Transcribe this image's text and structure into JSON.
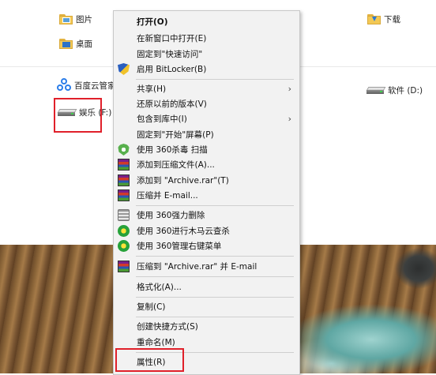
{
  "explorer": {
    "folders": [
      {
        "label": "图片",
        "icon": "pictures-folder-icon"
      },
      {
        "label": "桌面",
        "icon": "desktop-folder-icon"
      },
      {
        "label": "下载",
        "icon": "downloads-folder-icon"
      }
    ],
    "baidu_label": "百度云管家",
    "drives": [
      {
        "label": "娱乐 (F:)",
        "icon": "drive-icon"
      },
      {
        "label": "软件 (D:)",
        "icon": "drive-icon"
      }
    ]
  },
  "context_menu": {
    "items": [
      {
        "label": "打开(O)",
        "icon": "",
        "bold": true
      },
      {
        "label": "在新窗口中打开(E)",
        "icon": ""
      },
      {
        "label": "固定到\"快速访问\"",
        "icon": ""
      },
      {
        "label": "启用 BitLocker(B)",
        "icon": "bitlocker-shield-icon"
      },
      {
        "label": "共享(H)",
        "icon": "",
        "submenu": true
      },
      {
        "label": "还原以前的版本(V)",
        "icon": ""
      },
      {
        "label": "包含到库中(I)",
        "icon": "",
        "submenu": true
      },
      {
        "label": "固定到\"开始\"屏幕(P)",
        "icon": ""
      },
      {
        "label": "使用 360杀毒 扫描",
        "icon": "360-antivirus-icon"
      },
      {
        "label": "添加到压缩文件(A)...",
        "icon": "winrar-icon"
      },
      {
        "label": "添加到 \"Archive.rar\"(T)",
        "icon": "winrar-icon"
      },
      {
        "label": "压缩并 E-mail...",
        "icon": "winrar-icon"
      },
      {
        "label": "使用 360强力删除",
        "icon": "360-shredder-icon"
      },
      {
        "label": "使用 360进行木马云查杀",
        "icon": "360-trojan-scan-icon"
      },
      {
        "label": "使用 360管理右键菜单",
        "icon": "360-menu-manager-icon"
      },
      {
        "label": "压缩到 \"Archive.rar\" 并 E-mail",
        "icon": "winrar-icon"
      },
      {
        "label": "格式化(A)...",
        "icon": ""
      },
      {
        "label": "复制(C)",
        "icon": ""
      },
      {
        "label": "创建快捷方式(S)",
        "icon": ""
      },
      {
        "label": "重命名(M)",
        "icon": ""
      },
      {
        "label": "属性(R)",
        "icon": ""
      }
    ],
    "submenu_arrow": "›"
  },
  "colors": {
    "highlight_border": "#e0202a",
    "menu_background": "#f2f2f2"
  }
}
